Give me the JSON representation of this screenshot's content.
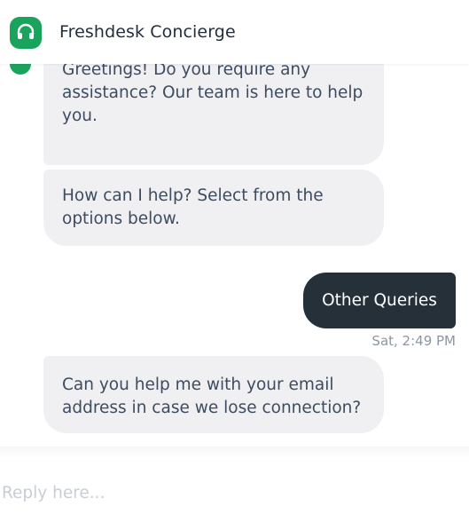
{
  "header": {
    "title": "Freshdesk Concierge",
    "logo_icon": "headset-icon",
    "brand_color": "#1aa35c"
  },
  "messages": [
    {
      "sender": "bot",
      "text": "Greetings! Do you require any assistance? Our team is here to help you."
    },
    {
      "sender": "bot",
      "text": "How can I help? Select from the options below."
    },
    {
      "sender": "user",
      "text": "Other Queries",
      "time": "Sat, 2:49 PM"
    },
    {
      "sender": "bot",
      "text": "Can you help me with your email address in case we lose connection?"
    }
  ],
  "composer": {
    "placeholder": "Reply here..."
  }
}
